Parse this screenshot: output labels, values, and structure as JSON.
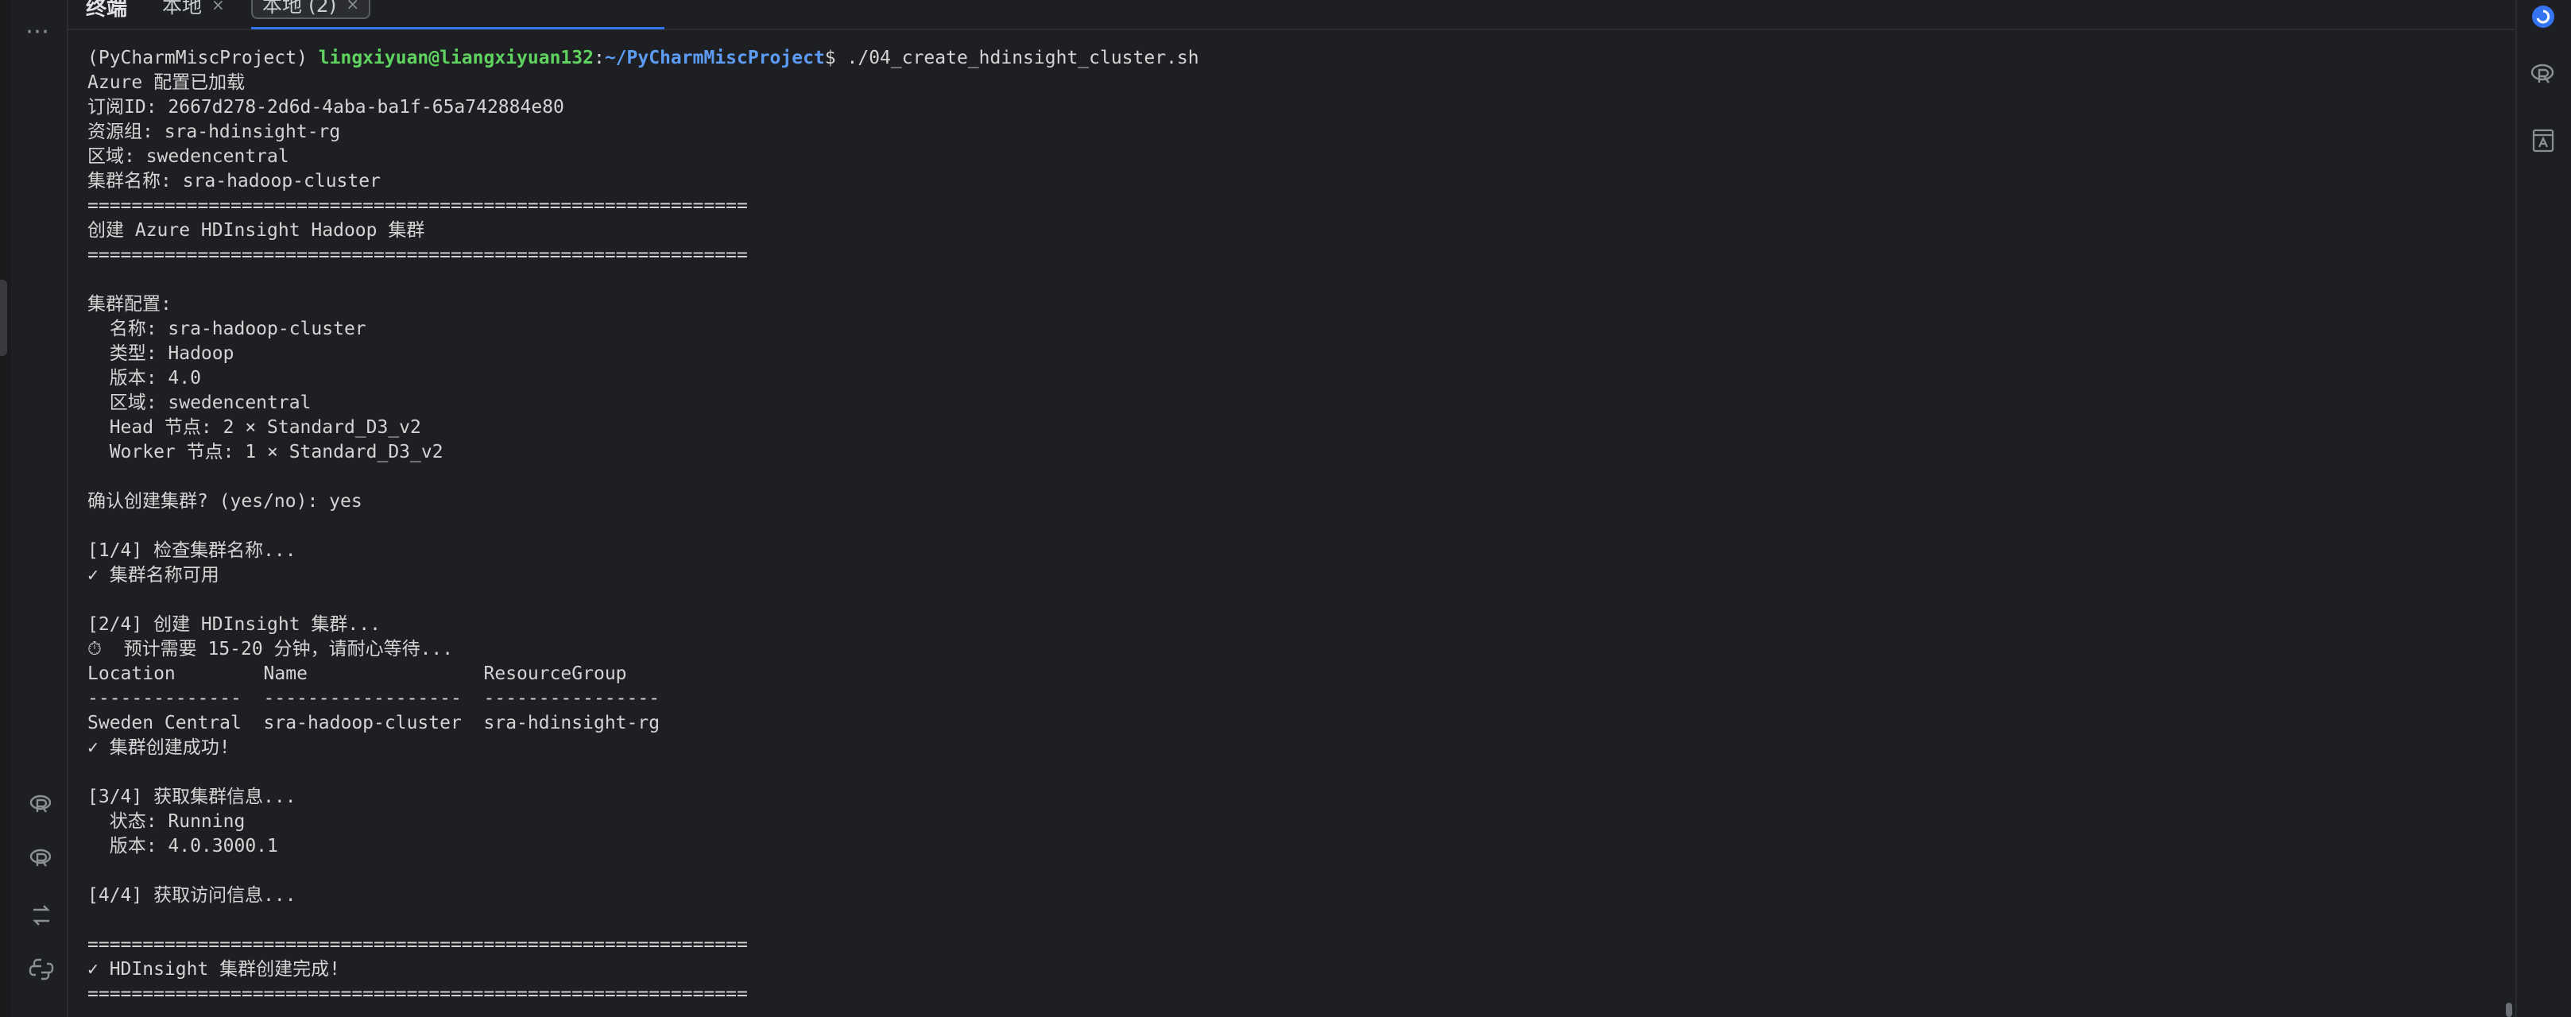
{
  "header": {
    "title": "终端",
    "tabs": [
      {
        "label": "本地",
        "close": "×"
      },
      {
        "label": "本地 (2)",
        "close": "×"
      }
    ]
  },
  "sidebar_left": {
    "more_label": "⋯",
    "icons": [
      "r-console-icon",
      "r-console-icon-2",
      "git-branches-icon",
      "python-console-icon"
    ]
  },
  "sidebar_right": {
    "icons": [
      "ai-assistant-icon",
      "r-icon",
      "text-translate-icon"
    ]
  },
  "terminal": {
    "prompt": {
      "env": "(PyCharmMiscProject) ",
      "user": "lingxiyuan@liangxiyuan132",
      "sep": ":",
      "path": "~/PyCharmMiscProject",
      "dollar": "$ ",
      "command": "./04_create_hdinsight_cluster.sh"
    },
    "lines": [
      "Azure 配置已加载",
      "订阅ID: 2667d278-2d6d-4aba-ba1f-65a742884e80",
      "资源组: sra-hdinsight-rg",
      "区域: swedencentral",
      "集群名称: sra-hadoop-cluster",
      "============================================================",
      "创建 Azure HDInsight Hadoop 集群",
      "============================================================",
      "",
      "集群配置:",
      "  名称: sra-hadoop-cluster",
      "  类型: Hadoop",
      "  版本: 4.0",
      "  区域: swedencentral",
      "  Head 节点: 2 × Standard_D3_v2",
      "  Worker 节点: 1 × Standard_D3_v2",
      "",
      "确认创建集群? (yes/no): yes",
      "",
      "[1/4] 检查集群名称...",
      "✓ 集群名称可用",
      "",
      "[2/4] 创建 HDInsight 集群...",
      "⏱  预计需要 15-20 分钟，请耐心等待...",
      "Location        Name                ResourceGroup",
      "--------------  ------------------  ----------------",
      "Sweden Central  sra-hadoop-cluster  sra-hdinsight-rg",
      "✓ 集群创建成功!",
      "",
      "[3/4] 获取集群信息...",
      "  状态: Running",
      "  版本: 4.0.3000.1",
      "",
      "[4/4] 获取访问信息...",
      "",
      "============================================================",
      "✓ HDInsight 集群创建完成!",
      "============================================================"
    ]
  },
  "colors": {
    "background": "#1e1f22",
    "text": "#d4d4d4",
    "user": "#5fd35f",
    "path": "#5c9cf5",
    "accent": "#3574f0"
  }
}
